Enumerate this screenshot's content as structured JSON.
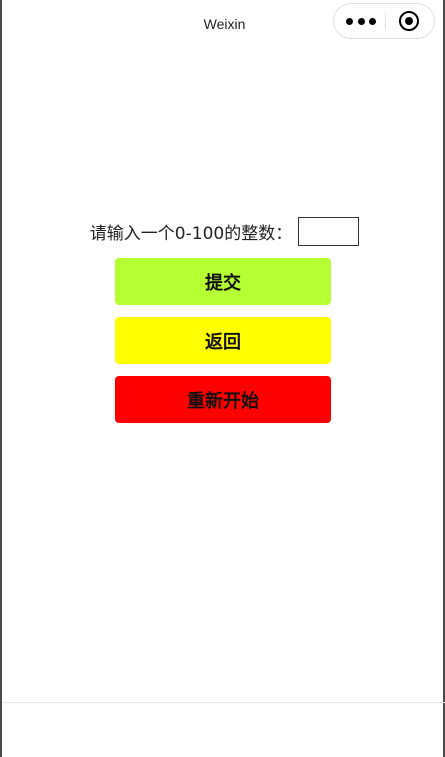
{
  "navbar": {
    "title": "Weixin",
    "menu_icon": "more-dots-icon",
    "close_icon": "target-circle-icon"
  },
  "form": {
    "prompt_label": "请输入一个0-100的整数：",
    "input_value": "",
    "input_placeholder": ""
  },
  "buttons": {
    "submit_label": "提交",
    "back_label": "返回",
    "restart_label": "重新开始"
  },
  "colors": {
    "submit_bg": "#b6ff33",
    "back_bg": "#ffff00",
    "restart_bg": "#ff0000"
  }
}
